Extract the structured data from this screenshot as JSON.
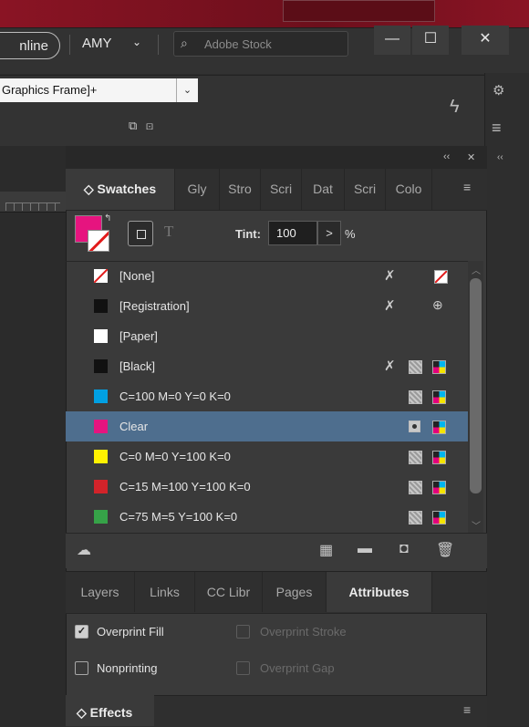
{
  "appbar": {
    "pill_label": "nline",
    "user_name": "AMY",
    "user_chevron": "⌄",
    "search_placeholder": "Adobe Stock",
    "min_glyph": "—",
    "max_glyph": "☐",
    "close_glyph": "✕"
  },
  "control": {
    "frame_style": "Graphics Frame]+",
    "dropdown_glyph": "⌄",
    "lightning_glyph": "ϟ"
  },
  "panel": {
    "collapse_glyph": "‹‹",
    "close_glyph": "✕",
    "tabs": [
      "Swatches",
      "Gly",
      "Stro",
      "Scri",
      "Dat",
      "Scri",
      "Colo"
    ],
    "active_tab_prefix": "◇ ",
    "menu_glyph": "≡",
    "tint_label": "Tint:",
    "tint_value": "100",
    "tint_arrow": ">",
    "tint_unit": "%",
    "format_text_glyph": "T"
  },
  "swatches": [
    {
      "name": "[None]",
      "chip": "none",
      "icons": [
        "x",
        "none"
      ]
    },
    {
      "name": "[Registration]",
      "chip": "#111111",
      "icons": [
        "x",
        "reg"
      ]
    },
    {
      "name": "[Paper]",
      "chip": "#ffffff",
      "icons": []
    },
    {
      "name": "[Black]",
      "chip": "#111111",
      "icons": [
        "x",
        "proc",
        "cmyk"
      ]
    },
    {
      "name": "C=100 M=0 Y=0 K=0",
      "chip": "#00a0e3",
      "icons": [
        "proc",
        "cmyk"
      ]
    },
    {
      "name": "Clear",
      "chip": "#e6147f",
      "icons": [
        "spot",
        "cmyk"
      ],
      "selected": true
    },
    {
      "name": "C=0 M=0 Y=100 K=0",
      "chip": "#fff200",
      "icons": [
        "proc",
        "cmyk"
      ]
    },
    {
      "name": "C=15 M=100 Y=100 K=0",
      "chip": "#d2232a",
      "icons": [
        "proc",
        "cmyk"
      ]
    },
    {
      "name": "C=75 M=5 Y=100 K=0",
      "chip": "#36a348",
      "icons": [
        "proc",
        "cmyk"
      ]
    }
  ],
  "bottom_panel": {
    "tabs": [
      "Layers",
      "Links",
      "CC Libr",
      "Pages",
      "Attributes"
    ],
    "active_tab": "Attributes",
    "options": [
      {
        "label": "Overprint Fill",
        "checked": true,
        "disabled": false
      },
      {
        "label": "Overprint Stroke",
        "checked": false,
        "disabled": true
      },
      {
        "label": "Nonprinting",
        "checked": false,
        "disabled": false
      },
      {
        "label": "Overprint Gap",
        "checked": false,
        "disabled": true
      }
    ]
  },
  "effects": {
    "label": "◇ Effects",
    "menu_glyph": "≡"
  },
  "colors": {
    "selection": "#4e6e8e",
    "fill": "#e6147f",
    "accent_red": "#e21b1b"
  }
}
